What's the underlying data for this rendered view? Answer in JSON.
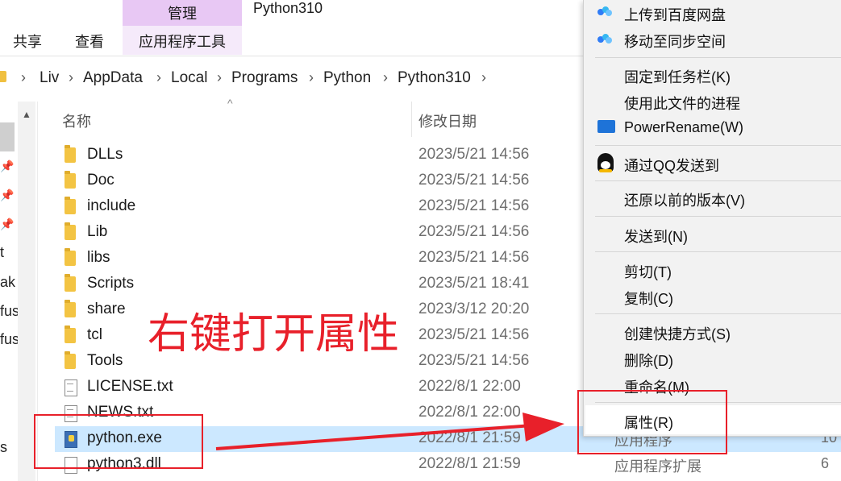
{
  "ribbon": {
    "manage_tab": "管理",
    "app_tools_tab": "应用程序工具",
    "share_tab": "共享",
    "view_tab": "查看",
    "window_title": "Python310"
  },
  "breadcrumb": [
    "Liv",
    "AppData",
    "Local",
    "Programs",
    "Python",
    "Python310"
  ],
  "nav_pane": {
    "partial_labels": [
      "t",
      "ak",
      "fus",
      "fus",
      "s"
    ]
  },
  "columns": {
    "name": "名称",
    "date": "修改日期"
  },
  "files": [
    {
      "name": "DLLs",
      "date": "2023/5/21 14:56",
      "kind": "folder",
      "type": "",
      "size": ""
    },
    {
      "name": "Doc",
      "date": "2023/5/21 14:56",
      "kind": "folder",
      "type": "",
      "size": ""
    },
    {
      "name": "include",
      "date": "2023/5/21 14:56",
      "kind": "folder",
      "type": "",
      "size": ""
    },
    {
      "name": "Lib",
      "date": "2023/5/21 14:56",
      "kind": "folder",
      "type": "",
      "size": ""
    },
    {
      "name": "libs",
      "date": "2023/5/21 14:56",
      "kind": "folder",
      "type": "",
      "size": ""
    },
    {
      "name": "Scripts",
      "date": "2023/5/21 18:41",
      "kind": "folder",
      "type": "",
      "size": ""
    },
    {
      "name": "share",
      "date": "2023/3/12 20:20",
      "kind": "folder",
      "type": "",
      "size": ""
    },
    {
      "name": "tcl",
      "date": "2023/5/21 14:56",
      "kind": "folder",
      "type": "",
      "size": ""
    },
    {
      "name": "Tools",
      "date": "2023/5/21 14:56",
      "kind": "folder",
      "type": "",
      "size": ""
    },
    {
      "name": "LICENSE.txt",
      "date": "2022/8/1 22:00",
      "kind": "txt",
      "type": "",
      "size": ""
    },
    {
      "name": "NEWS.txt",
      "date": "2022/8/1 22:00",
      "kind": "txt",
      "type": "",
      "size": ""
    },
    {
      "name": "python.exe",
      "date": "2022/8/1 21:59",
      "kind": "exe",
      "type": "应用程序",
      "size": "10",
      "selected": true
    },
    {
      "name": "python3.dll",
      "date": "2022/8/1 21:59",
      "kind": "dll",
      "type": "应用程序扩展",
      "size": "6"
    }
  ],
  "context_menu": {
    "upload_baidu": "上传到百度网盘",
    "move_sync": "移动至同步空间",
    "pin_taskbar": "固定到任务栏(K)",
    "processes": "使用此文件的进程",
    "powerrename": "PowerRename(W)",
    "send_qq": "通过QQ发送到",
    "restore": "还原以前的版本(V)",
    "send_to": "发送到(N)",
    "cut": "剪切(T)",
    "copy": "复制(C)",
    "shortcut": "创建快捷方式(S)",
    "delete": "删除(D)",
    "rename": "重命名(M)",
    "properties": "属性(R)"
  },
  "annotation": {
    "text": "右键打开属性",
    "color": "#e8202a"
  },
  "colors": {
    "manage_tab_bg": "#e8c8f4",
    "selection": "#cce8ff",
    "folder": "#f3c443"
  }
}
